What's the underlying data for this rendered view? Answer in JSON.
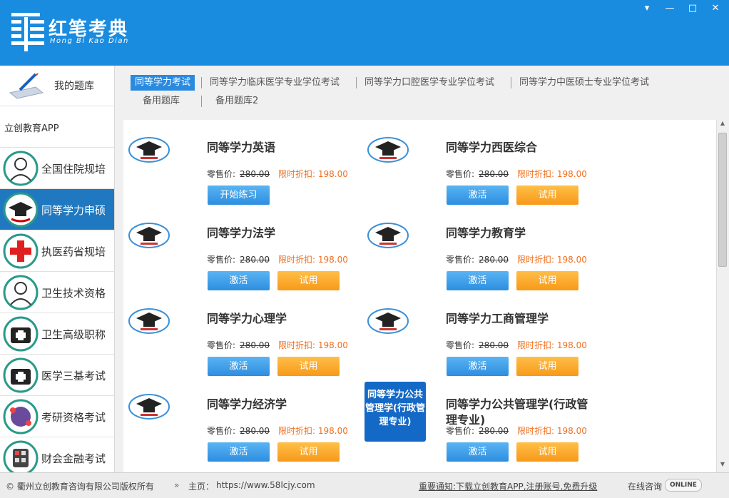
{
  "app": {
    "title": "红笔考典",
    "subtitle": "Hong Bi Kao Dian"
  },
  "window": {
    "minimize": "—",
    "restore": "□",
    "close": "✕",
    "menu": "▾"
  },
  "sidebar": {
    "my_bank": "我的题库",
    "app_label": "立创教育APP",
    "items": [
      {
        "label": "全国住院规培",
        "icon": "doctor-icon"
      },
      {
        "label": "同等学力申硕",
        "icon": "graduation-cap-icon",
        "active": true
      },
      {
        "label": "执医药省规培",
        "icon": "red-cross-icon"
      },
      {
        "label": "卫生技术资格",
        "icon": "nurse-icon"
      },
      {
        "label": "卫生高级职称",
        "icon": "medical-kit-icon"
      },
      {
        "label": "医学三基考试",
        "icon": "medical-case-icon"
      },
      {
        "label": "考研资格考试",
        "icon": "molecule-icon"
      },
      {
        "label": "财会金融考试",
        "icon": "calculator-icon"
      }
    ]
  },
  "tabs": [
    {
      "label": "同等学力考试",
      "active": true
    },
    {
      "label": "同等学力临床医学专业学位考试"
    },
    {
      "label": "同等学力口腔医学专业学位考试"
    },
    {
      "label": "同等学力中医硕士专业学位考试"
    },
    {
      "label": "备用题库"
    },
    {
      "label": "备用题库2"
    }
  ],
  "price_labels": {
    "retail": "零售价:",
    "original": "280.00",
    "discount": "限时折扣: 198.00"
  },
  "buttons": {
    "start": "开始练习",
    "activate": "激活",
    "trial": "试用"
  },
  "cards": [
    {
      "title": "同等学力英语",
      "mode": "start"
    },
    {
      "title": "同等学力西医综合",
      "mode": "trial"
    },
    {
      "title": "同等学力法学",
      "mode": "trial"
    },
    {
      "title": "同等学力教育学",
      "mode": "trial"
    },
    {
      "title": "同等学力心理学",
      "mode": "trial"
    },
    {
      "title": "同等学力工商管理学",
      "mode": "trial"
    },
    {
      "title": "同等学力经济学",
      "mode": "trial"
    },
    {
      "title": "同等学力公共管理学(行政管理专业)",
      "mode": "trial",
      "cover": "同等学力公共管理学(行政管理专业)"
    }
  ],
  "footer": {
    "copyright": "© 衢州立创教育咨询有限公司版权所有",
    "home_label": "主页：",
    "home_url": "https://www.58lcjy.com",
    "notice": "重要通知:下载立创教育APP,注册账号,免费升级",
    "online_label": "在线咨询",
    "online_badge": "ONLINE"
  },
  "colors": {
    "title_bar": "#1a8ce0",
    "active_sidebar": "#2079c0",
    "blue_button": "#2d8ee0",
    "orange_button": "#f7991a",
    "discount": "#f07020"
  }
}
